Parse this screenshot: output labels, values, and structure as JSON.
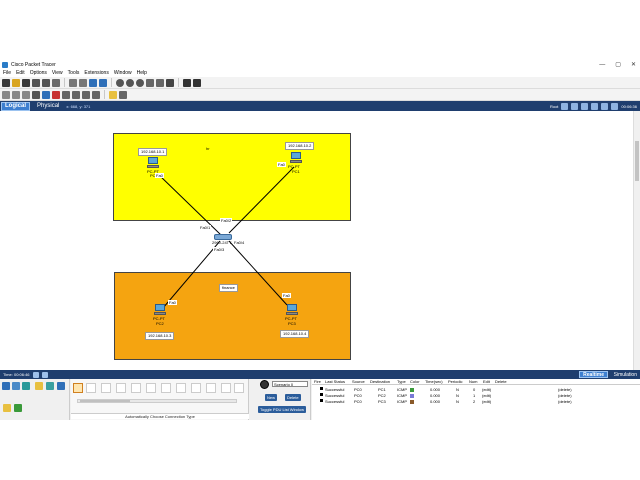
{
  "window": {
    "title": "Cisco Packet Tracer",
    "controls": [
      "—",
      "▢",
      "✕"
    ]
  },
  "menu": [
    "File",
    "Edit",
    "Options",
    "View",
    "Tools",
    "Extensions",
    "Window",
    "Help"
  ],
  "modebar": {
    "logical": "Logical",
    "physical": "Physical",
    "coords": "x: 668, y: 371",
    "root": "Root",
    "clock": "00:06:36"
  },
  "zones": {
    "hr": "hr",
    "finance": "finance"
  },
  "devices": {
    "pc0": {
      "name_line1": "PC-PT",
      "name_line2": "PC0",
      "ip": "192.168.10.1",
      "port": "Fa0"
    },
    "pc1": {
      "name_line1": "PC-PT",
      "name_line2": "PC1",
      "ip": "192.168.10.2",
      "port": "Fa0"
    },
    "pc2": {
      "name_line1": "PC-PT",
      "name_line2": "PC2",
      "ip": "192.168.10.3",
      "port": "Fa0"
    },
    "pc3": {
      "name_line1": "PC-PT",
      "name_line2": "PC3",
      "ip": "192.168.10.4",
      "port": "Fa0"
    },
    "switch": {
      "name": "2960-24TT",
      "port_fa01": "Fa0/1",
      "port_fa02": "Fa0/2",
      "port_fa03": "Fa0/3",
      "port_fa04": "Fa0/4"
    }
  },
  "timebar": {
    "time": "Time: 00:06:46",
    "realtime": "Realtime",
    "simulation": "Simulation"
  },
  "bottom": {
    "auto_connection": "Automatically Choose Connection Type",
    "scenario_select": "Scenario 0",
    "new_label": "New",
    "delete_label": "Delete",
    "toggle_label": "Toggle PDU List Window"
  },
  "pdu_table": {
    "headers": [
      "Fire",
      "Last Status",
      "Source",
      "Destination",
      "Type",
      "Color",
      "Time(sec)",
      "Periodic",
      "Num",
      "Edit",
      "Delete"
    ],
    "rows": [
      {
        "status": "Successful",
        "source": "PC0",
        "destination": "PC1",
        "type": "ICMP",
        "color": "#3a9a3a",
        "time": "0.000",
        "periodic": "N",
        "num": "0",
        "edit": "(edit)",
        "delete": "(delete)"
      },
      {
        "status": "Successful",
        "source": "PC0",
        "destination": "PC2",
        "type": "ICMP",
        "color": "#7a7ad6",
        "time": "0.000",
        "periodic": "N",
        "num": "1",
        "edit": "(edit)",
        "delete": "(delete)"
      },
      {
        "status": "Successful",
        "source": "PC0",
        "destination": "PC3",
        "type": "ICMP",
        "color": "#8a5a2a",
        "time": "0.000",
        "periodic": "N",
        "num": "2",
        "edit": "(edit)",
        "delete": "(delete)"
      }
    ]
  },
  "colors": {
    "hr_zone": "#ffff00",
    "finance_zone": "#f5a410",
    "accent": "#1f3e6e"
  }
}
